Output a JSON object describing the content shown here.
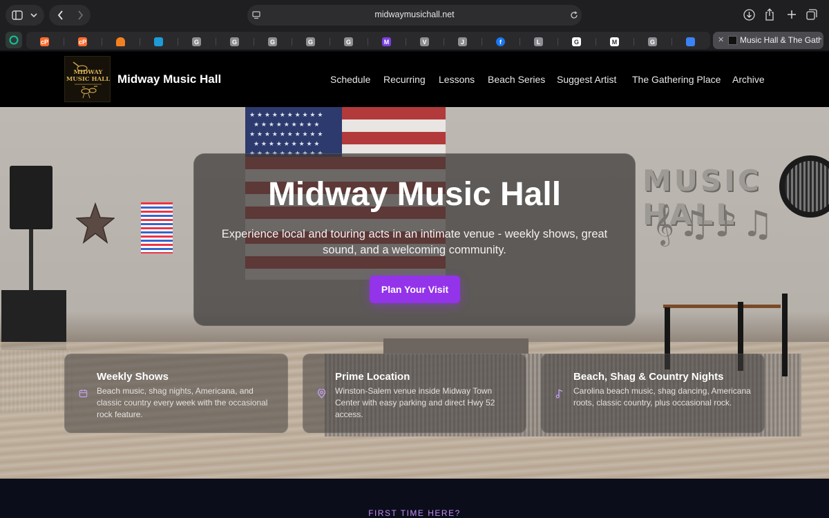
{
  "browser": {
    "url": "midwaymusichall.net",
    "active_tab_title": "Music Hall & The Gathering Place",
    "favorites": [
      {
        "name": "grammarly-icon",
        "letter": "",
        "color": "#15c39a"
      },
      {
        "name": "cpanel-icon",
        "letter": "cP",
        "color": "#ff6c2c"
      },
      {
        "name": "cpanel-icon-2",
        "letter": "cP",
        "color": "#ff6c2c"
      },
      {
        "name": "cloudflare-icon",
        "letter": "",
        "color": "#f38020"
      },
      {
        "name": "tiles-icon",
        "letter": "",
        "color": "#1e9bd7"
      },
      {
        "name": "g-icon-1",
        "letter": "G",
        "color": "#8e8e93"
      },
      {
        "name": "g-icon-2",
        "letter": "G",
        "color": "#8e8e93"
      },
      {
        "name": "g-icon-3",
        "letter": "G",
        "color": "#8e8e93"
      },
      {
        "name": "g-icon-4",
        "letter": "G",
        "color": "#8e8e93"
      },
      {
        "name": "g-icon-5",
        "letter": "G",
        "color": "#8e8e93"
      },
      {
        "name": "m-icon",
        "letter": "M",
        "color": "#7b3fe4"
      },
      {
        "name": "v-icon",
        "letter": "V",
        "color": "#8e8e93"
      },
      {
        "name": "j-icon",
        "letter": "J",
        "color": "#8e8e93"
      },
      {
        "name": "facebook-icon",
        "letter": "f",
        "color": "#1877f2"
      },
      {
        "name": "l-icon",
        "letter": "L",
        "color": "#8e8e93"
      },
      {
        "name": "google-icon",
        "letter": "G",
        "color": "#ffffff"
      },
      {
        "name": "m-box-icon",
        "letter": "M",
        "color": "#ffffff"
      },
      {
        "name": "g-icon-6",
        "letter": "G",
        "color": "#8e8e93"
      },
      {
        "name": "cloud-icon",
        "letter": "",
        "color": "#3b82f6"
      }
    ]
  },
  "site": {
    "logo_text": "MIDWAY MUSIC HALL",
    "brand": "Midway Music Hall",
    "nav": [
      "Schedule",
      "Recurring",
      "Lessons",
      "Beach Series",
      "Suggest Artist",
      "The Gathering Place",
      "Archive"
    ]
  },
  "hero": {
    "title": "Midway Music Hall",
    "subtitle": "Experience local and touring acts in an intimate venue - weekly shows, great sound, and a welcoming community.",
    "cta": "Plan Your Visit",
    "wall_text": "MUSIC HALL"
  },
  "features": [
    {
      "icon": "calendar-icon",
      "title": "Weekly Shows",
      "desc": "Beach music, shag nights, Americana, and classic country every week with the occasional rock feature."
    },
    {
      "icon": "map-pin-icon",
      "title": "Prime Location",
      "desc": "Winston-Salem venue inside Midway Town Center with easy parking and direct Hwy 52 access."
    },
    {
      "icon": "music-note-icon",
      "title": "Beach, Shag & Country Nights",
      "desc": "Carolina beach music, shag dancing, Americana roots, classic country, plus occasional rock."
    }
  ],
  "section": {
    "eyebrow": "FIRST TIME HERE?"
  },
  "colors": {
    "accent": "#9333ea",
    "accent_light": "#c58cf9",
    "header_bg": "#000000",
    "band_bg": "#0b0e1a"
  }
}
